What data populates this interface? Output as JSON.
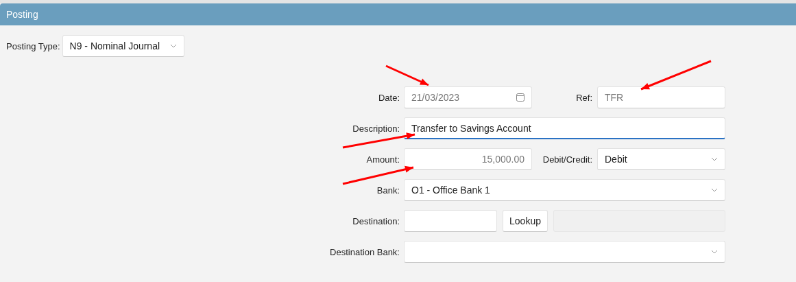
{
  "panel": {
    "title": "Posting"
  },
  "posting_type": {
    "label": "Posting Type:",
    "value": "N9 - Nominal Journal"
  },
  "rows": [
    {
      "label": "Date:",
      "controls": [
        {
          "kind": "date",
          "value": "21/03/2023",
          "focused": false
        },
        {
          "kind": "label",
          "text": "Ref:"
        },
        {
          "kind": "text",
          "value": "TFR",
          "focused": false
        }
      ]
    },
    {
      "label": "Description:",
      "controls": [
        {
          "kind": "text",
          "value": "Transfer to Savings Account",
          "focused": true
        }
      ]
    },
    {
      "label": "Amount:",
      "controls": [
        {
          "kind": "number",
          "value": "15,000.00",
          "focused": false
        },
        {
          "kind": "label",
          "text": "Debit/Credit:"
        },
        {
          "kind": "select",
          "value": "Debit"
        }
      ]
    },
    {
      "label": "Bank:",
      "controls": [
        {
          "kind": "select",
          "value": "O1 - Office Bank 1"
        }
      ]
    },
    {
      "label": "Destination:",
      "controls": [
        {
          "kind": "text",
          "focused": false
        },
        {
          "kind": "button",
          "text": "Lookup"
        },
        {
          "kind": "readonly"
        }
      ]
    },
    {
      "label": "Destination Bank:",
      "controls": [
        {
          "kind": "select"
        }
      ]
    }
  ]
}
